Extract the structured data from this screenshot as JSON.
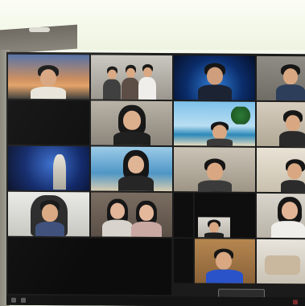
{
  "meeting": {
    "bottom_pill_label": "",
    "tiles": [
      {
        "id": "t1",
        "name": ""
      },
      {
        "id": "t2",
        "name": ""
      },
      {
        "id": "t3",
        "name": ""
      },
      {
        "id": "t4",
        "name": ""
      },
      {
        "id": "t5",
        "name": ""
      },
      {
        "id": "t6",
        "name": ""
      },
      {
        "id": "t7",
        "name": ""
      },
      {
        "id": "t8",
        "name": ""
      },
      {
        "id": "t9",
        "name": ""
      },
      {
        "id": "t10",
        "name": ""
      },
      {
        "id": "t11",
        "name": ""
      },
      {
        "id": "t12",
        "name": ""
      },
      {
        "id": "t13",
        "name": ""
      },
      {
        "id": "t14",
        "name": ""
      },
      {
        "id": "t15",
        "name": ""
      },
      {
        "id": "t16",
        "name": ""
      },
      {
        "id": "t17",
        "name": ""
      },
      {
        "id": "t18",
        "name": ""
      },
      {
        "id": "t19",
        "name": ""
      },
      {
        "id": "t20",
        "name": ""
      },
      {
        "id": "t21",
        "name": ""
      }
    ]
  },
  "colors": {
    "tile_border": "#1b1b1b",
    "sky_sunset": "#e09a58",
    "space_blue": "#0b2d6b",
    "beach_sky": "#6fb6e3",
    "sea": "#2b88b8"
  }
}
